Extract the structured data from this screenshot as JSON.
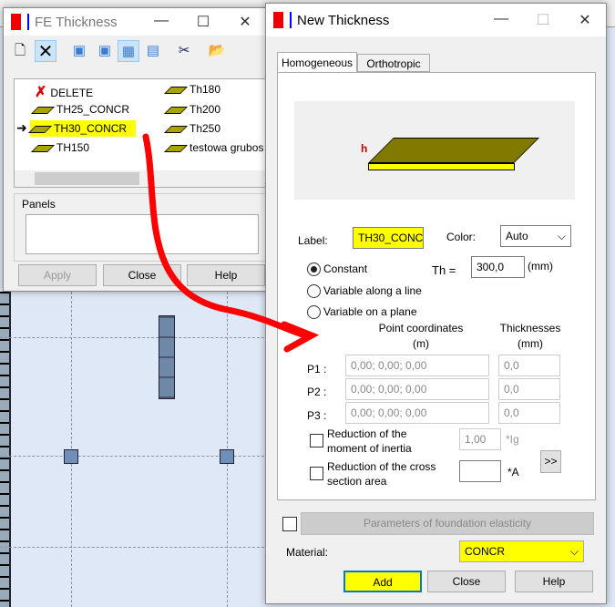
{
  "fe_dialog": {
    "title": "FE Thickness",
    "toolbar": [
      "new-icon",
      "delete-icon",
      "view1-icon",
      "view2-icon",
      "view3-icon",
      "view4-icon",
      "cut-icon",
      "open-icon"
    ],
    "items": [
      {
        "label": "DELETE",
        "icon": "delete-x-icon"
      },
      {
        "label": "TH25_CONCR"
      },
      {
        "label": "TH30_CONCR",
        "selected": true
      },
      {
        "label": "TH150"
      },
      {
        "label": "Th180"
      },
      {
        "label": "Th200"
      },
      {
        "label": "Th250"
      },
      {
        "label": "testowa grubos"
      }
    ],
    "panels_label": "Panels",
    "panels_value": "",
    "apply": "Apply",
    "close": "Close",
    "help": "Help"
  },
  "new_dialog": {
    "title": "New Thickness",
    "tabs": [
      "Homogeneous",
      "Orthotropic"
    ],
    "active_tab": "Homogeneous",
    "preview_h": "h",
    "label_label": "Label:",
    "label_value": "TH30_CONC",
    "color_label": "Color:",
    "color_value": "Auto",
    "constant": "Constant",
    "along_line": "Variable along a line",
    "on_plane": "Variable on a plane",
    "selected_mode": "Constant",
    "th_label": "Th =",
    "th_value": "300,0",
    "th_unit": "(mm)",
    "point_coords_header": "Point coordinates",
    "point_coords_unit": "(m)",
    "thick_header": "Thicknesses",
    "thick_unit": "(mm)",
    "points": [
      {
        "label": "P1 :",
        "coords": "0,00; 0,00; 0,00",
        "th": "0,0"
      },
      {
        "label": "P2 :",
        "coords": "0,00; 0,00; 0,00",
        "th": "0,0"
      },
      {
        "label": "P3 :",
        "coords": "0,00; 0,00; 0,00",
        "th": "0,0"
      }
    ],
    "red_inertia_1": "Reduction of the",
    "red_inertia_2": "moment of inertia",
    "red_inertia_value": "1,00",
    "red_inertia_unit": "*Ig",
    "red_area_1": "Reduction of the cross",
    "red_area_2": "section area",
    "red_area_value": "",
    "red_area_unit": "*A",
    "more": ">>",
    "foundation": "Parameters of foundation elasticity",
    "material_label": "Material:",
    "material_value": "CONCR",
    "add": "Add",
    "close": "Close",
    "help": "Help"
  }
}
